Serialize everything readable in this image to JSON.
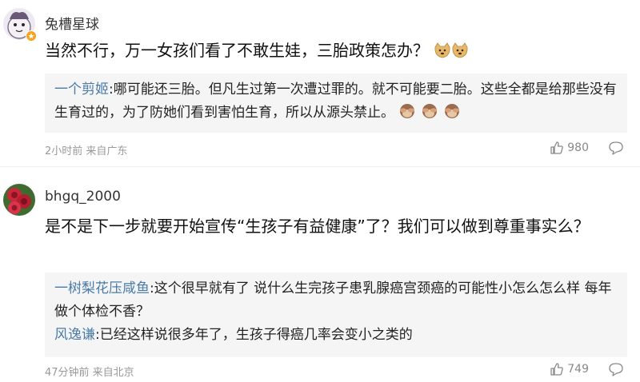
{
  "comments": [
    {
      "username": "兔槽星球",
      "text": "当然不行，万一女孩们看了不敢生娃，三胎政策怎办？",
      "emoji": "doge-icon",
      "replies": [
        {
          "name": "一个剪姬",
          "text": ":哪可能还三胎。但凡生过第一次遭过罪的。就不可能要二胎。这些全都是给那些没有生育过的，为了防她们看到害怕生育，所以从源头禁止。",
          "emoji": "see-no-evil-monkey-icon"
        }
      ],
      "meta": "2小时前 来自广东",
      "likes": "980"
    },
    {
      "username": "bhgq_2000",
      "text": "是不是下一步就要开始宣传“生孩子有益健康”了？我们可以做到尊重事实么？",
      "replies": [
        {
          "name": "一树梨花压咸鱼",
          "text": ":这个很早就有了 说什么生完孩子患乳腺癌宫颈癌的可能性小怎么怎么样 每年做个体检不香？"
        },
        {
          "name": "风逸谦",
          "text": ":已经这样说很多年了，生孩子得癌几率会变小之类的"
        }
      ],
      "meta": "47分钟前 来自北京",
      "likes": "749"
    }
  ],
  "colors": {
    "reply_name": "#4a7ba8",
    "reply_bg": "#f5f5f5",
    "meta": "#999999"
  }
}
